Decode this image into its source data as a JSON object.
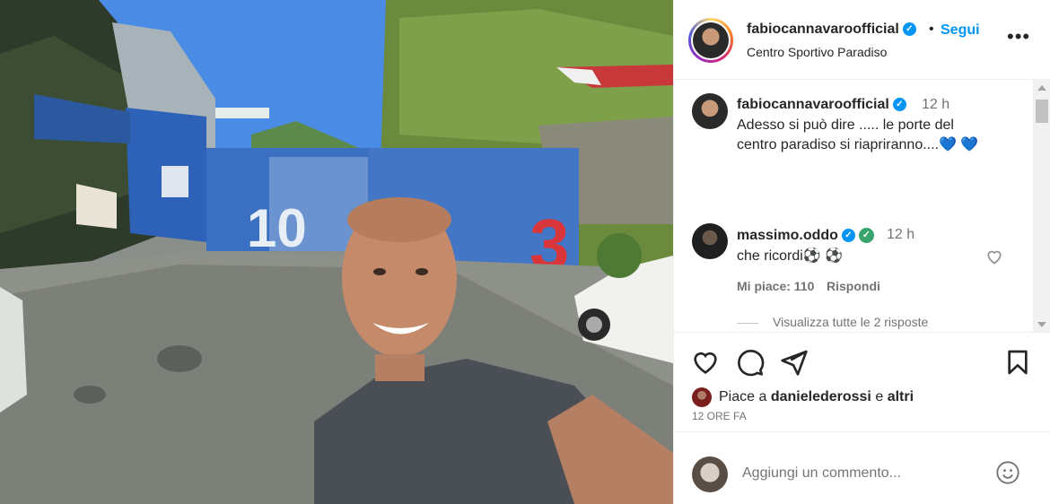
{
  "post": {
    "photo_alt": "Selfie at Centro Sportivo Paradiso",
    "header": {
      "username": "fabiocannavaroofficial",
      "separator": "•",
      "follow_label": "Segui",
      "location": "Centro Sportivo Paradiso",
      "more_label": "•••"
    },
    "caption": {
      "username": "fabiocannavaroofficial",
      "time": "12 h",
      "text_line1": "Adesso si può dire ..... le porte del",
      "text_line2": "centro paradiso si riapriranno....",
      "hearts": "💙 💙"
    },
    "comments": [
      {
        "username": "massimo.oddo",
        "time": "12 h",
        "text": "che ricordi⚽ ⚽ 󠁿󠁿",
        "likes": "Mi piace: 110",
        "reply_label": "Rispondi",
        "view_replies": "Visualizza tutte le 2 risposte"
      }
    ],
    "likes": {
      "prefix": "Piace a",
      "user": "danielederossi",
      "joiner": "e",
      "others": "altri"
    },
    "timestamp": "12 ORE FA",
    "add_comment_placeholder": "Aggiungi un commento...",
    "colors": {
      "accent": "#0095f6",
      "secondary_text": "#737373",
      "border": "#efefef"
    },
    "icons": [
      "heart-icon",
      "comment-icon",
      "share-icon",
      "bookmark-icon",
      "emoji-icon",
      "verified-icon",
      "more-icon"
    ]
  }
}
